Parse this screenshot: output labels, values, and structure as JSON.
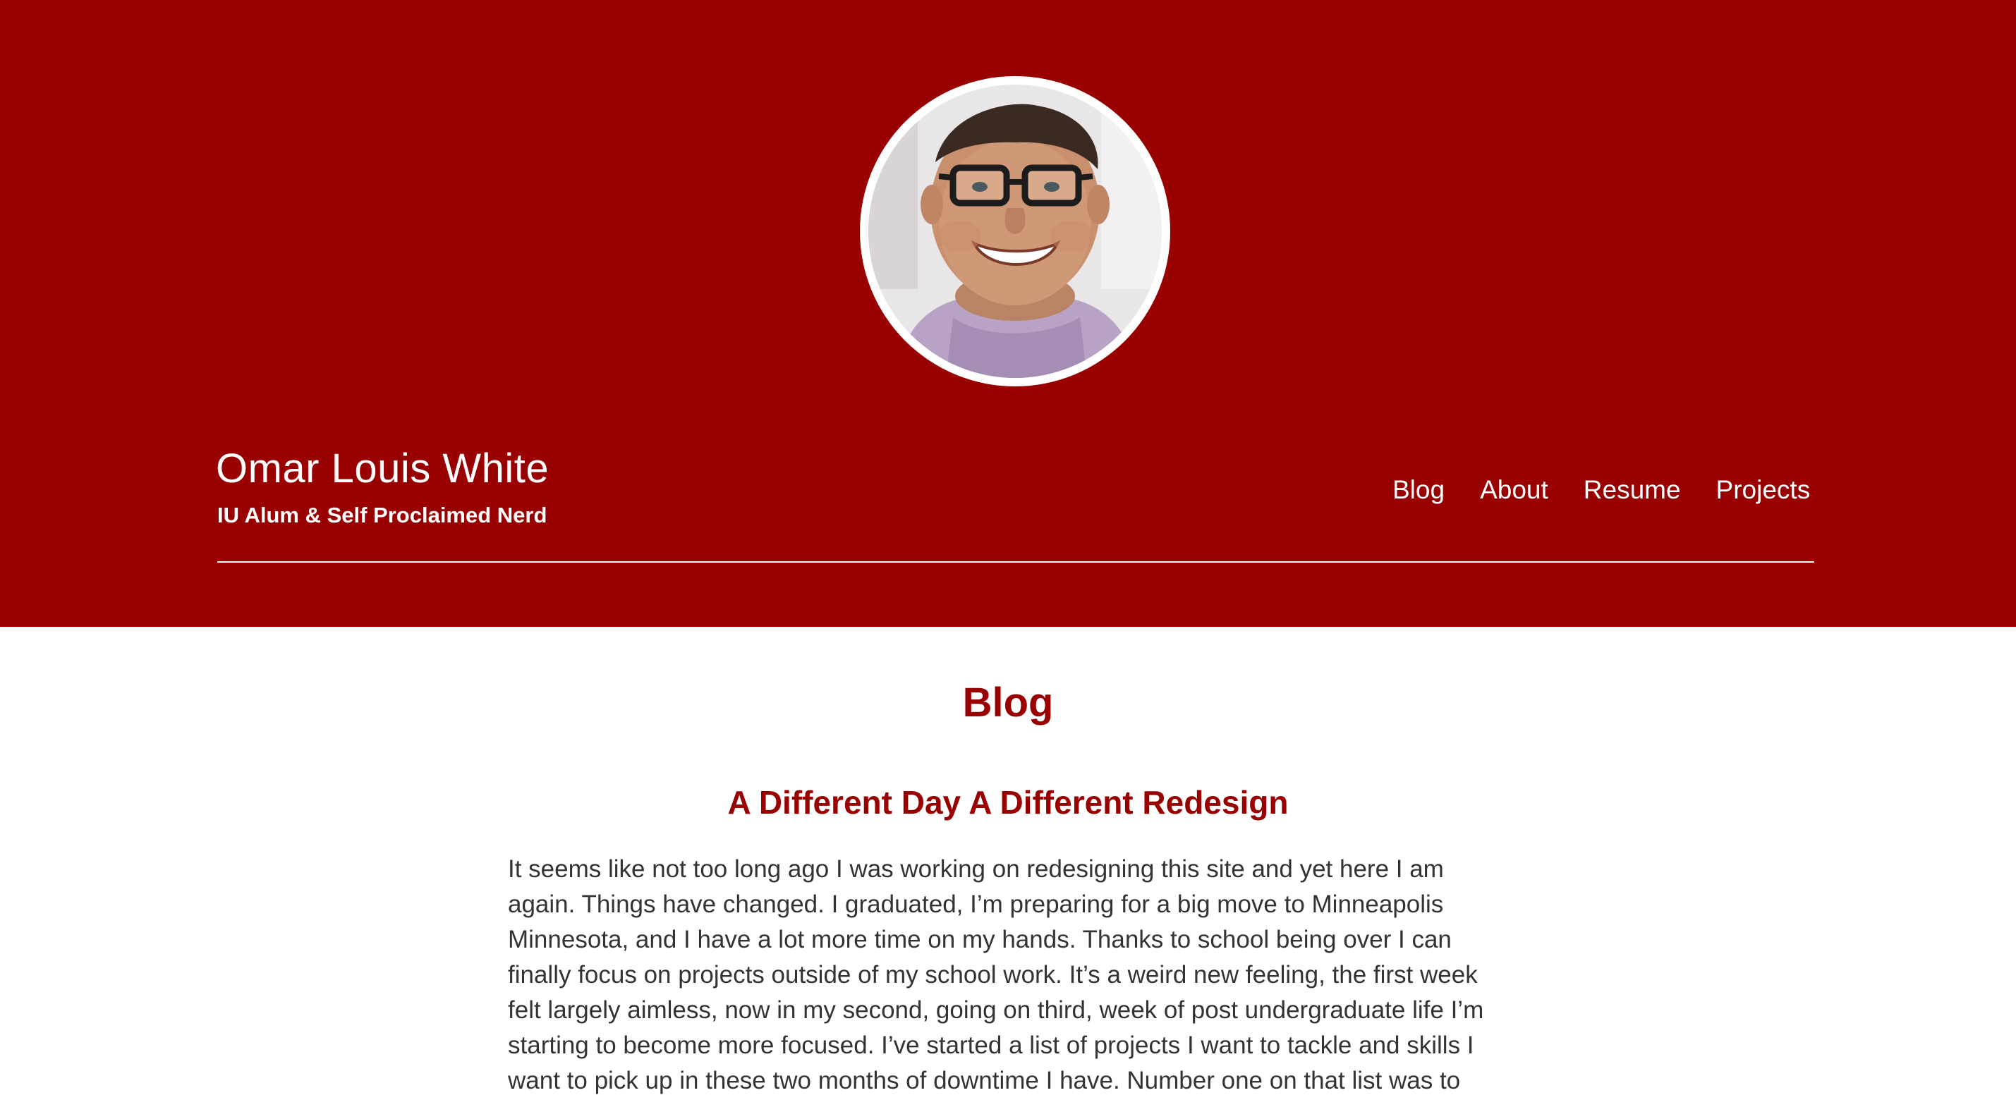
{
  "header": {
    "background_color": "#990000",
    "avatar_alt": "Portrait of Omar Louis White",
    "site_title": "Omar Louis White",
    "tagline": "IU Alum & Self Proclaimed Nerd",
    "nav": [
      {
        "label": "Blog"
      },
      {
        "label": "About"
      },
      {
        "label": "Resume"
      },
      {
        "label": "Projects"
      }
    ]
  },
  "main": {
    "page_heading": "Blog",
    "accent_color": "#990000",
    "post": {
      "title": "A Different Day A Different Redesign",
      "body_lines": [
        "It seems like not too long ago I was working on redesigning this site and yet here I am",
        "again. Things have changed. I graduated, I’m preparing for a big move to Minneapolis",
        "Minnesota, and I have a lot more time on my hands. Thanks to school being over I can",
        "finally focus on projects outside of my school work. It’s a weird new feeling, the first week",
        "felt largely aimless, now in my second, going on third, week of post undergraduate life I’m",
        "starting to become more focused. I’ve started a list of projects I want to tackle and skills I",
        "want to pick up in these two months of downtime I have. Number one on that list was to"
      ]
    }
  }
}
